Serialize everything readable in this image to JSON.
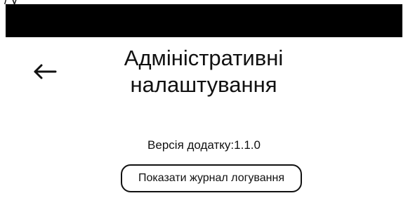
{
  "top_clipped_text": "/ y",
  "header": {
    "back_icon": "arrow-left-icon",
    "title_line1": "Адміністративні",
    "title_line2": "налаштування"
  },
  "app_version": {
    "label": "Версія додатку:",
    "value": "1.1.0"
  },
  "actions": {
    "show_log_label": "Показати журнал логування"
  },
  "colors": {
    "background": "#ffffff",
    "text": "#111111",
    "status_bar": "#000000"
  }
}
